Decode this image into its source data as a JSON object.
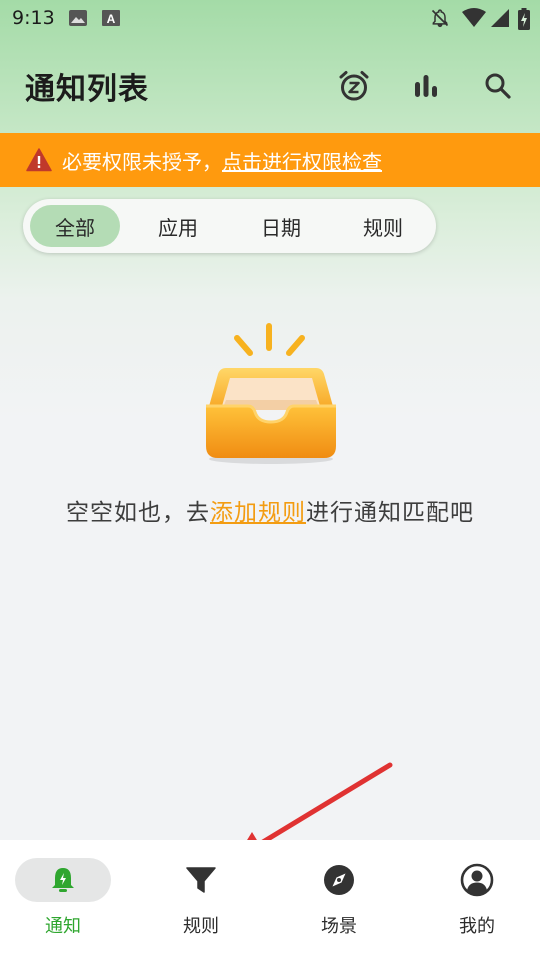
{
  "status_bar": {
    "time": "9:13",
    "icons": [
      "image-icon",
      "a-notification-icon",
      "bell-off-icon",
      "wifi-icon",
      "signal-icon",
      "battery-charging-icon"
    ]
  },
  "header": {
    "title": "通知列表",
    "actions": [
      "snooze-icon",
      "stats-icon",
      "search-icon"
    ]
  },
  "banner": {
    "icon": "warning-icon",
    "text": "必要权限未授予，",
    "link": "点击进行权限检查",
    "color": "#ff9a0e"
  },
  "tabs": {
    "items": [
      "全部",
      "应用",
      "日期",
      "规则"
    ],
    "selected": "全部"
  },
  "empty_state": {
    "illustration": "empty-inbox-illustration",
    "text_before": "空空如也，去",
    "link": "添加规则",
    "text_after": "进行通知匹配吧"
  },
  "bottom_nav": {
    "items": [
      {
        "label": "通知",
        "icon": "bell-icon"
      },
      {
        "label": "规则",
        "icon": "filter-icon"
      },
      {
        "label": "场景",
        "icon": "compass-icon"
      },
      {
        "label": "我的",
        "icon": "user-icon"
      }
    ],
    "selected": "通知",
    "accent": "#2fa62f"
  }
}
